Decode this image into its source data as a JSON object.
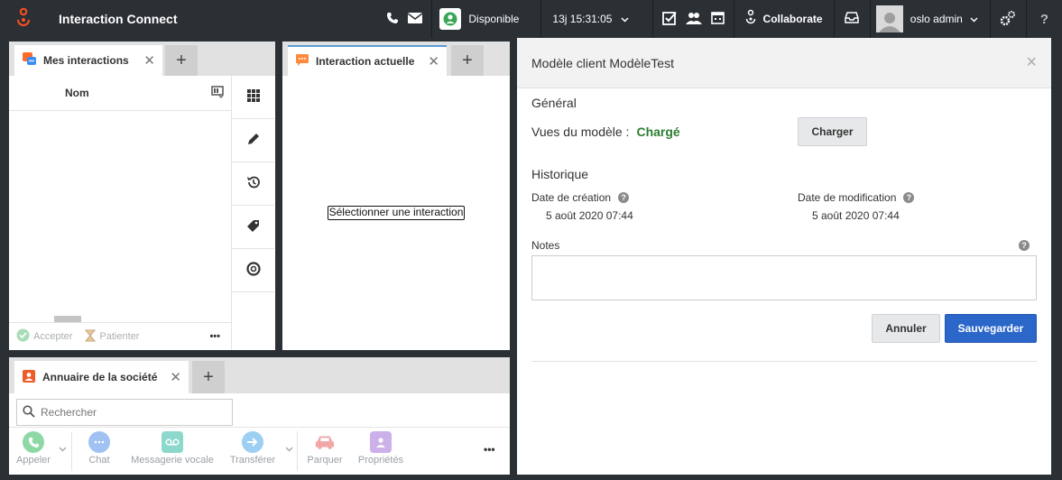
{
  "topbar": {
    "app_title": "Interaction Connect",
    "status_label": "Disponible",
    "time": "13j 15:31:05",
    "collaborate_label": "Collaborate",
    "user_name": "oslo admin",
    "help_label": "?"
  },
  "my_interactions": {
    "tab_label": "Mes interactions",
    "column_name": "Nom",
    "accept_label": "Accepter",
    "hold_label": "Patienter",
    "more_label": "•••"
  },
  "current_interaction": {
    "tab_label": "Interaction actuelle",
    "empty_message": "Sélectionner une interaction"
  },
  "directory": {
    "tab_label": "Annuaire de la société",
    "search_placeholder": "Rechercher",
    "actions": [
      {
        "label": "Appeler",
        "color": "#7fd49a"
      },
      {
        "label": "Chat",
        "color": "#8fb7f0"
      },
      {
        "label": "Messagerie vocale",
        "color": "#7fd4c8"
      },
      {
        "label": "Transférer",
        "color": "#8fc8f0"
      },
      {
        "label": "Parquer",
        "color": "#f0a0a0"
      },
      {
        "label": "Propriétés",
        "color": "#c6a6e8"
      }
    ],
    "more_label": "•••"
  },
  "modal": {
    "title": "Modèle client ModèleTest",
    "close_label": "×",
    "general_title": "Général",
    "views_label": "Vues du modèle :",
    "views_value": "Chargé",
    "load_button": "Charger",
    "history_title": "Historique",
    "created_label": "Date de création",
    "created_value": "5 août 2020 07:44",
    "modified_label": "Date de modification",
    "modified_value": "5 août 2020 07:44",
    "notes_label": "Notes",
    "notes_value": "",
    "cancel_button": "Annuler",
    "save_button": "Sauvegarder"
  },
  "colors": {
    "brand": "#ff4f1f",
    "topbar": "#2b3035",
    "primary": "#2b66c9",
    "loaded": "#2e7d32"
  }
}
